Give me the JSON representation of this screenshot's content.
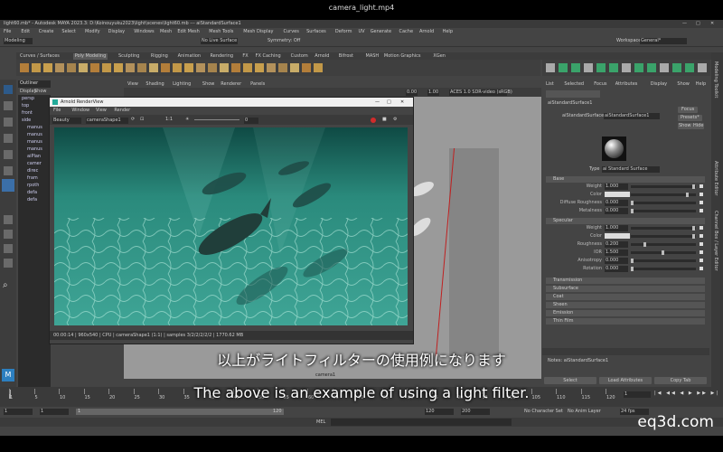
{
  "player": {
    "title": "camera_light.mp4"
  },
  "window": {
    "title": "light60.mb* - Autodesk MAYA 2023.3: D:\\Koinouyuku2023\\light\\scenes\\light60.mb  ---  aiStandardSurface1",
    "controls": [
      "—",
      "□",
      "✕"
    ]
  },
  "menu": [
    "File",
    "Edit",
    "Create",
    "Select",
    "Modify",
    "Display",
    "Windows",
    "Mesh",
    "Edit Mesh",
    "Mesh Tools",
    "Mesh Display",
    "Curves",
    "Surfaces",
    "Deform",
    "UV",
    "Generate",
    "Cache",
    "Arnold",
    "Help"
  ],
  "workspace": {
    "label": "Workspace:",
    "value": "General*"
  },
  "status": {
    "mode": "Modeling",
    "no_live": "No Live Surface",
    "symmetry": "Symmetry: Off"
  },
  "shelf_tabs": [
    "Curves / Surfaces",
    "Poly Modeling",
    "Sculpting",
    "Rigging",
    "Animation",
    "Rendering",
    "FX",
    "FX Caching",
    "Custom",
    "Arnold",
    "Bifrost",
    "MASH",
    "Motion Graphics",
    "XGen"
  ],
  "shelf_active": "Poly Modeling",
  "outliner": {
    "title": "Outliner",
    "menu": [
      "Display",
      "Show",
      "Help"
    ],
    "items": [
      "persp",
      "top",
      "front",
      "side",
      "manus",
      "manus",
      "manus",
      "manus",
      "aiPlan",
      "camer",
      "direc",
      "fram",
      "rpoth",
      "defa",
      "defa"
    ]
  },
  "viewport": {
    "menu": [
      "View",
      "Shading",
      "Lighting",
      "Show",
      "Renderer",
      "Panels"
    ],
    "exposure": "0.00",
    "gamma": "1.00",
    "colorspace": "ACES 1.0 SDR-video (sRGB)",
    "camera_label": "camera1"
  },
  "renderview": {
    "title": "Arnold RenderView",
    "menu": [
      "File",
      "Window",
      "View",
      "Render"
    ],
    "mode": "Beauty",
    "camera": "cameraShape1",
    "ratio": "1:1",
    "exposure": "0",
    "status": "00:00:14 | 960x540 | CPU | cameraShape1 (1:1) | samples 3/2/2/2/2/2 | 1770.62 MB"
  },
  "attr": {
    "menu": [
      "List",
      "Selected",
      "Focus",
      "Attributes",
      "Display",
      "Show",
      "Help"
    ],
    "tab": "aiStandardSurface1",
    "node_label": "aiStandardSurface:",
    "node_value": "aiStandardSurface1",
    "buttons": [
      "Focus",
      "Presets*",
      "Show",
      "Hide"
    ],
    "type_label": "Type",
    "type_value": "ai Standard Surface",
    "base": {
      "title": "Base",
      "rows": [
        {
          "label": "Weight",
          "value": "1.000",
          "fill": 1.0
        },
        {
          "label": "Color",
          "value": "",
          "fill": 0.9
        },
        {
          "label": "Diffuse Roughness",
          "value": "0.000",
          "fill": 0
        },
        {
          "label": "Metalness",
          "value": "0.000",
          "fill": 0
        }
      ]
    },
    "specular": {
      "title": "Specular",
      "rows": [
        {
          "label": "Weight",
          "value": "1.000",
          "fill": 1.0
        },
        {
          "label": "Color",
          "value": "",
          "fill": 1.0
        },
        {
          "label": "Roughness",
          "value": "0.200",
          "fill": 0.2
        },
        {
          "label": "IOR",
          "value": "1.500",
          "fill": 0.5
        },
        {
          "label": "Anisotropy",
          "value": "0.000",
          "fill": 0
        },
        {
          "label": "Rotation",
          "value": "0.000",
          "fill": 0
        }
      ]
    },
    "sections": [
      "Transmission",
      "Subsurface",
      "Coat",
      "Sheen",
      "Emission",
      "Thin Film"
    ],
    "notes": "Notes: aiStandardSurface1",
    "bottom_buttons": [
      "Select",
      "Load Attributes",
      "Copy Tab"
    ]
  },
  "right_tabs": [
    "Modeling Toolkit",
    "Attribute Editor",
    "Channel Box / Layer Editor"
  ],
  "timeline": {
    "ticks": [
      "1",
      "5",
      "10",
      "15",
      "20",
      "25",
      "30",
      "35",
      "40",
      "45",
      "50",
      "55",
      "60",
      "65",
      "70",
      "75",
      "80",
      "85",
      "90",
      "95",
      "100",
      "105",
      "110",
      "115",
      "120"
    ],
    "current": "1"
  },
  "range": {
    "start": "1",
    "start2": "1",
    "end_inner": "120",
    "end": "120",
    "end2": "200",
    "charset": "No Character Set",
    "anim_layer": "No Anim Layer",
    "fps": "24 fps"
  },
  "cmd": {
    "label": "MEL"
  },
  "subtitles": {
    "jp": "以上がライトフィルターの使用例になります",
    "en": "The above is an example of using a light filter."
  },
  "brand": "eq3d.com",
  "colors": {
    "accent": "#4a90d9",
    "water": "#2f8f80",
    "record": "#d12b2b"
  }
}
